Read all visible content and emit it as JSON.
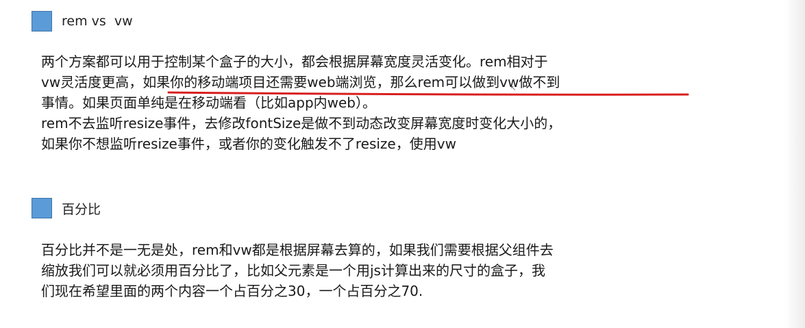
{
  "section1": {
    "heading": "rem vs  vw",
    "lines": [
      "两个方案都可以用于控制某个盒子的大小，都会根据屏幕宽度灵活变化。rem相对于",
      "vw灵活度更高，如果你的移动端项目还需要web端浏览，那么rem可以做到vw做不到",
      "事情。如果页面单纯是在移动端看（比如app内web）。",
      "rem不去监听resize事件，去修改fontSize是做不到动态改变屏幕宽度时变化大小的，",
      "如果你不想监听resize事件，或者你的变化触发不了resize，使用vw"
    ]
  },
  "section2": {
    "heading": "百分比",
    "lines": [
      "百分比并不是一无是处，rem和vw都是根据屏幕去算的，如果我们需要根据父组件去",
      "缩放我们可以就必须用百分比了，比如父元素是一个用js计算出来的尺寸的盒子，我",
      "们现在希望里面的两个内容一个占百分之30，一个占百分之70."
    ]
  },
  "colors": {
    "heading_square": "#5a9bd8",
    "annotation_underline": "#d81e1e"
  }
}
